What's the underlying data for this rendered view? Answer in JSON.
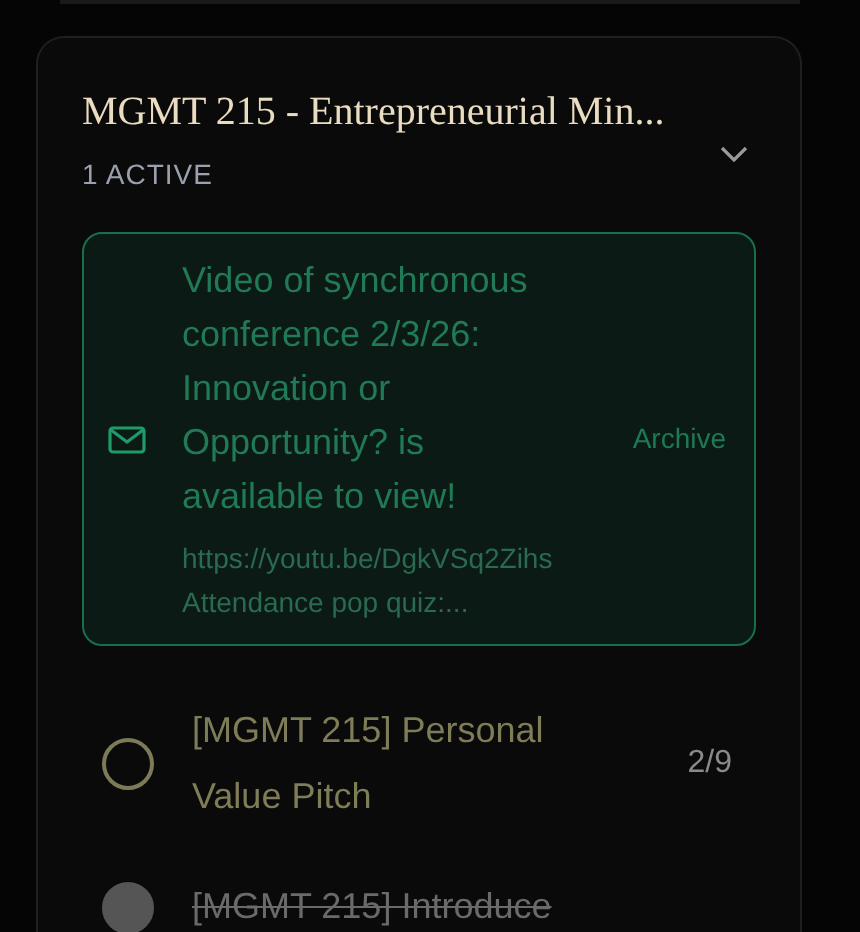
{
  "course": {
    "title": "MGMT 215 - Entrepreneurial Min...",
    "active_count": "1 ACTIVE",
    "expanded": true
  },
  "announcement": {
    "title": "Video of synchronous conference 2/3/26: Innovation or Opportunity? is available to view!",
    "preview": [
      "https://youtu.be/DgkVSq2Zihs",
      "Attendance pop quiz:..."
    ],
    "action": "Archive"
  },
  "tasks": [
    {
      "title": "[MGMT 215] Personal Value Pitch",
      "count": "2/9",
      "done": false
    },
    {
      "title": "[MGMT 215] Introduce",
      "done": true
    }
  ]
}
